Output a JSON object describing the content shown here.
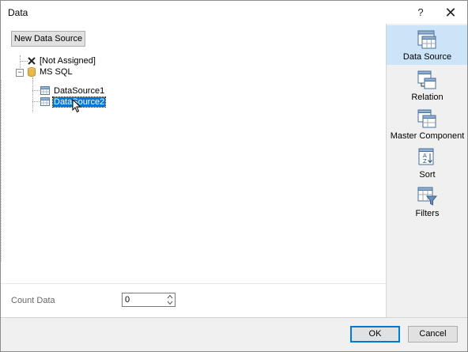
{
  "window": {
    "title": "Data",
    "help_label": "?",
    "close_label": "✕"
  },
  "toolbar": {
    "new_data_source_label": "New Data Source"
  },
  "tree": {
    "not_assigned": "[Not Assigned]",
    "connection": "MS SQL",
    "connection_expander": "−",
    "datasources": [
      {
        "label": "DataSource1",
        "selected": false
      },
      {
        "label": "DataSource2",
        "selected": true
      }
    ]
  },
  "count": {
    "label": "Count Data",
    "value": "0"
  },
  "side_panel": {
    "items": [
      {
        "label": "Data Source",
        "icon": "data-source-icon",
        "active": true
      },
      {
        "label": "Relation",
        "icon": "relation-icon",
        "active": false
      },
      {
        "label": "Master Component",
        "icon": "master-component-icon",
        "active": false
      },
      {
        "label": "Sort",
        "icon": "sort-icon",
        "active": false
      },
      {
        "label": "Filters",
        "icon": "filters-icon",
        "active": false
      }
    ]
  },
  "footer": {
    "ok_label": "OK",
    "cancel_label": "Cancel"
  },
  "colors": {
    "selection": "#0078d7",
    "side_active": "#cce4f7",
    "panel_bg": "#f0f0f0",
    "db_icon": "#e8b84a"
  }
}
